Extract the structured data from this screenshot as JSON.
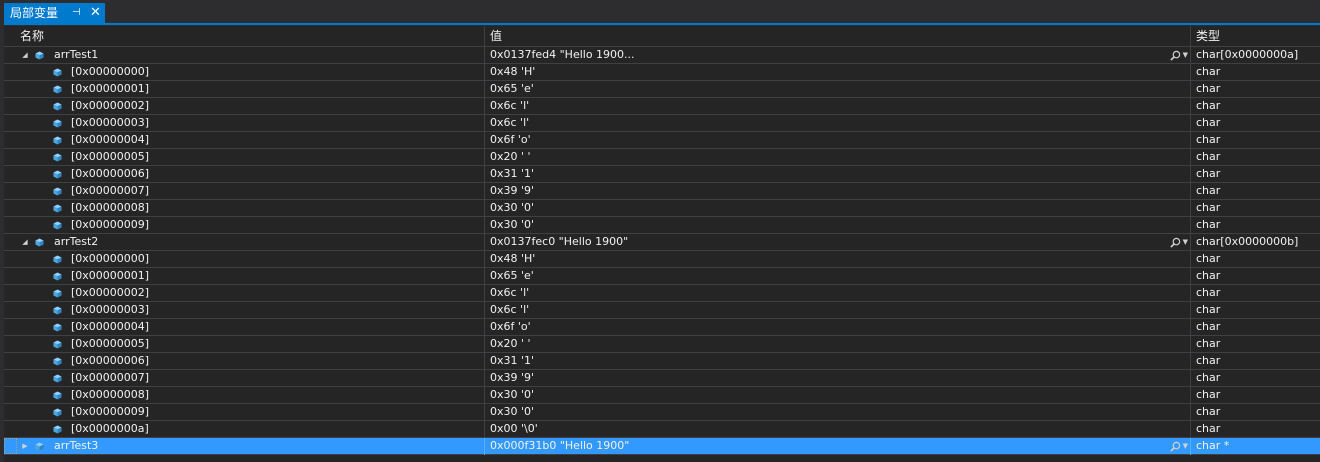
{
  "tab": {
    "title": "局部变量",
    "pin_glyph": "⊣",
    "close_glyph": "✕"
  },
  "columns": {
    "name": "名称",
    "value": "值",
    "type": "类型"
  },
  "colors": {
    "accent": "#007acc",
    "selection": "#3399ff",
    "background": "#252526",
    "grid_line": "#3f3f46",
    "value_icon": "#4ea6dc"
  },
  "rows": [
    {
      "level": 0,
      "expander": "expanded",
      "name": "arrTest1",
      "value": "0x0137fed4 \"Hello 1900...",
      "type": "char[0x0000000a]",
      "has_visualizer": true
    },
    {
      "level": 1,
      "expander": "none",
      "name": "[0x00000000]",
      "value": "0x48 'H'",
      "type": "char"
    },
    {
      "level": 1,
      "expander": "none",
      "name": "[0x00000001]",
      "value": "0x65 'e'",
      "type": "char"
    },
    {
      "level": 1,
      "expander": "none",
      "name": "[0x00000002]",
      "value": "0x6c 'l'",
      "type": "char"
    },
    {
      "level": 1,
      "expander": "none",
      "name": "[0x00000003]",
      "value": "0x6c 'l'",
      "type": "char"
    },
    {
      "level": 1,
      "expander": "none",
      "name": "[0x00000004]",
      "value": "0x6f 'o'",
      "type": "char"
    },
    {
      "level": 1,
      "expander": "none",
      "name": "[0x00000005]",
      "value": "0x20 ' '",
      "type": "char"
    },
    {
      "level": 1,
      "expander": "none",
      "name": "[0x00000006]",
      "value": "0x31 '1'",
      "type": "char"
    },
    {
      "level": 1,
      "expander": "none",
      "name": "[0x00000007]",
      "value": "0x39 '9'",
      "type": "char"
    },
    {
      "level": 1,
      "expander": "none",
      "name": "[0x00000008]",
      "value": "0x30 '0'",
      "type": "char"
    },
    {
      "level": 1,
      "expander": "none",
      "name": "[0x00000009]",
      "value": "0x30 '0'",
      "type": "char"
    },
    {
      "level": 0,
      "expander": "expanded",
      "name": "arrTest2",
      "value": "0x0137fec0 \"Hello 1900\"",
      "type": "char[0x0000000b]",
      "has_visualizer": true
    },
    {
      "level": 1,
      "expander": "none",
      "name": "[0x00000000]",
      "value": "0x48 'H'",
      "type": "char"
    },
    {
      "level": 1,
      "expander": "none",
      "name": "[0x00000001]",
      "value": "0x65 'e'",
      "type": "char"
    },
    {
      "level": 1,
      "expander": "none",
      "name": "[0x00000002]",
      "value": "0x6c 'l'",
      "type": "char"
    },
    {
      "level": 1,
      "expander": "none",
      "name": "[0x00000003]",
      "value": "0x6c 'l'",
      "type": "char"
    },
    {
      "level": 1,
      "expander": "none",
      "name": "[0x00000004]",
      "value": "0x6f 'o'",
      "type": "char"
    },
    {
      "level": 1,
      "expander": "none",
      "name": "[0x00000005]",
      "value": "0x20 ' '",
      "type": "char"
    },
    {
      "level": 1,
      "expander": "none",
      "name": "[0x00000006]",
      "value": "0x31 '1'",
      "type": "char"
    },
    {
      "level": 1,
      "expander": "none",
      "name": "[0x00000007]",
      "value": "0x39 '9'",
      "type": "char"
    },
    {
      "level": 1,
      "expander": "none",
      "name": "[0x00000008]",
      "value": "0x30 '0'",
      "type": "char"
    },
    {
      "level": 1,
      "expander": "none",
      "name": "[0x00000009]",
      "value": "0x30 '0'",
      "type": "char"
    },
    {
      "level": 1,
      "expander": "none",
      "name": "[0x0000000a]",
      "value": "0x00 '\\0'",
      "type": "char"
    },
    {
      "level": 0,
      "expander": "collapsed",
      "name": "arrTest3",
      "value": "0x000f31b0 \"Hello 1900\"",
      "type": "char *",
      "has_visualizer": true,
      "selected": true
    }
  ]
}
